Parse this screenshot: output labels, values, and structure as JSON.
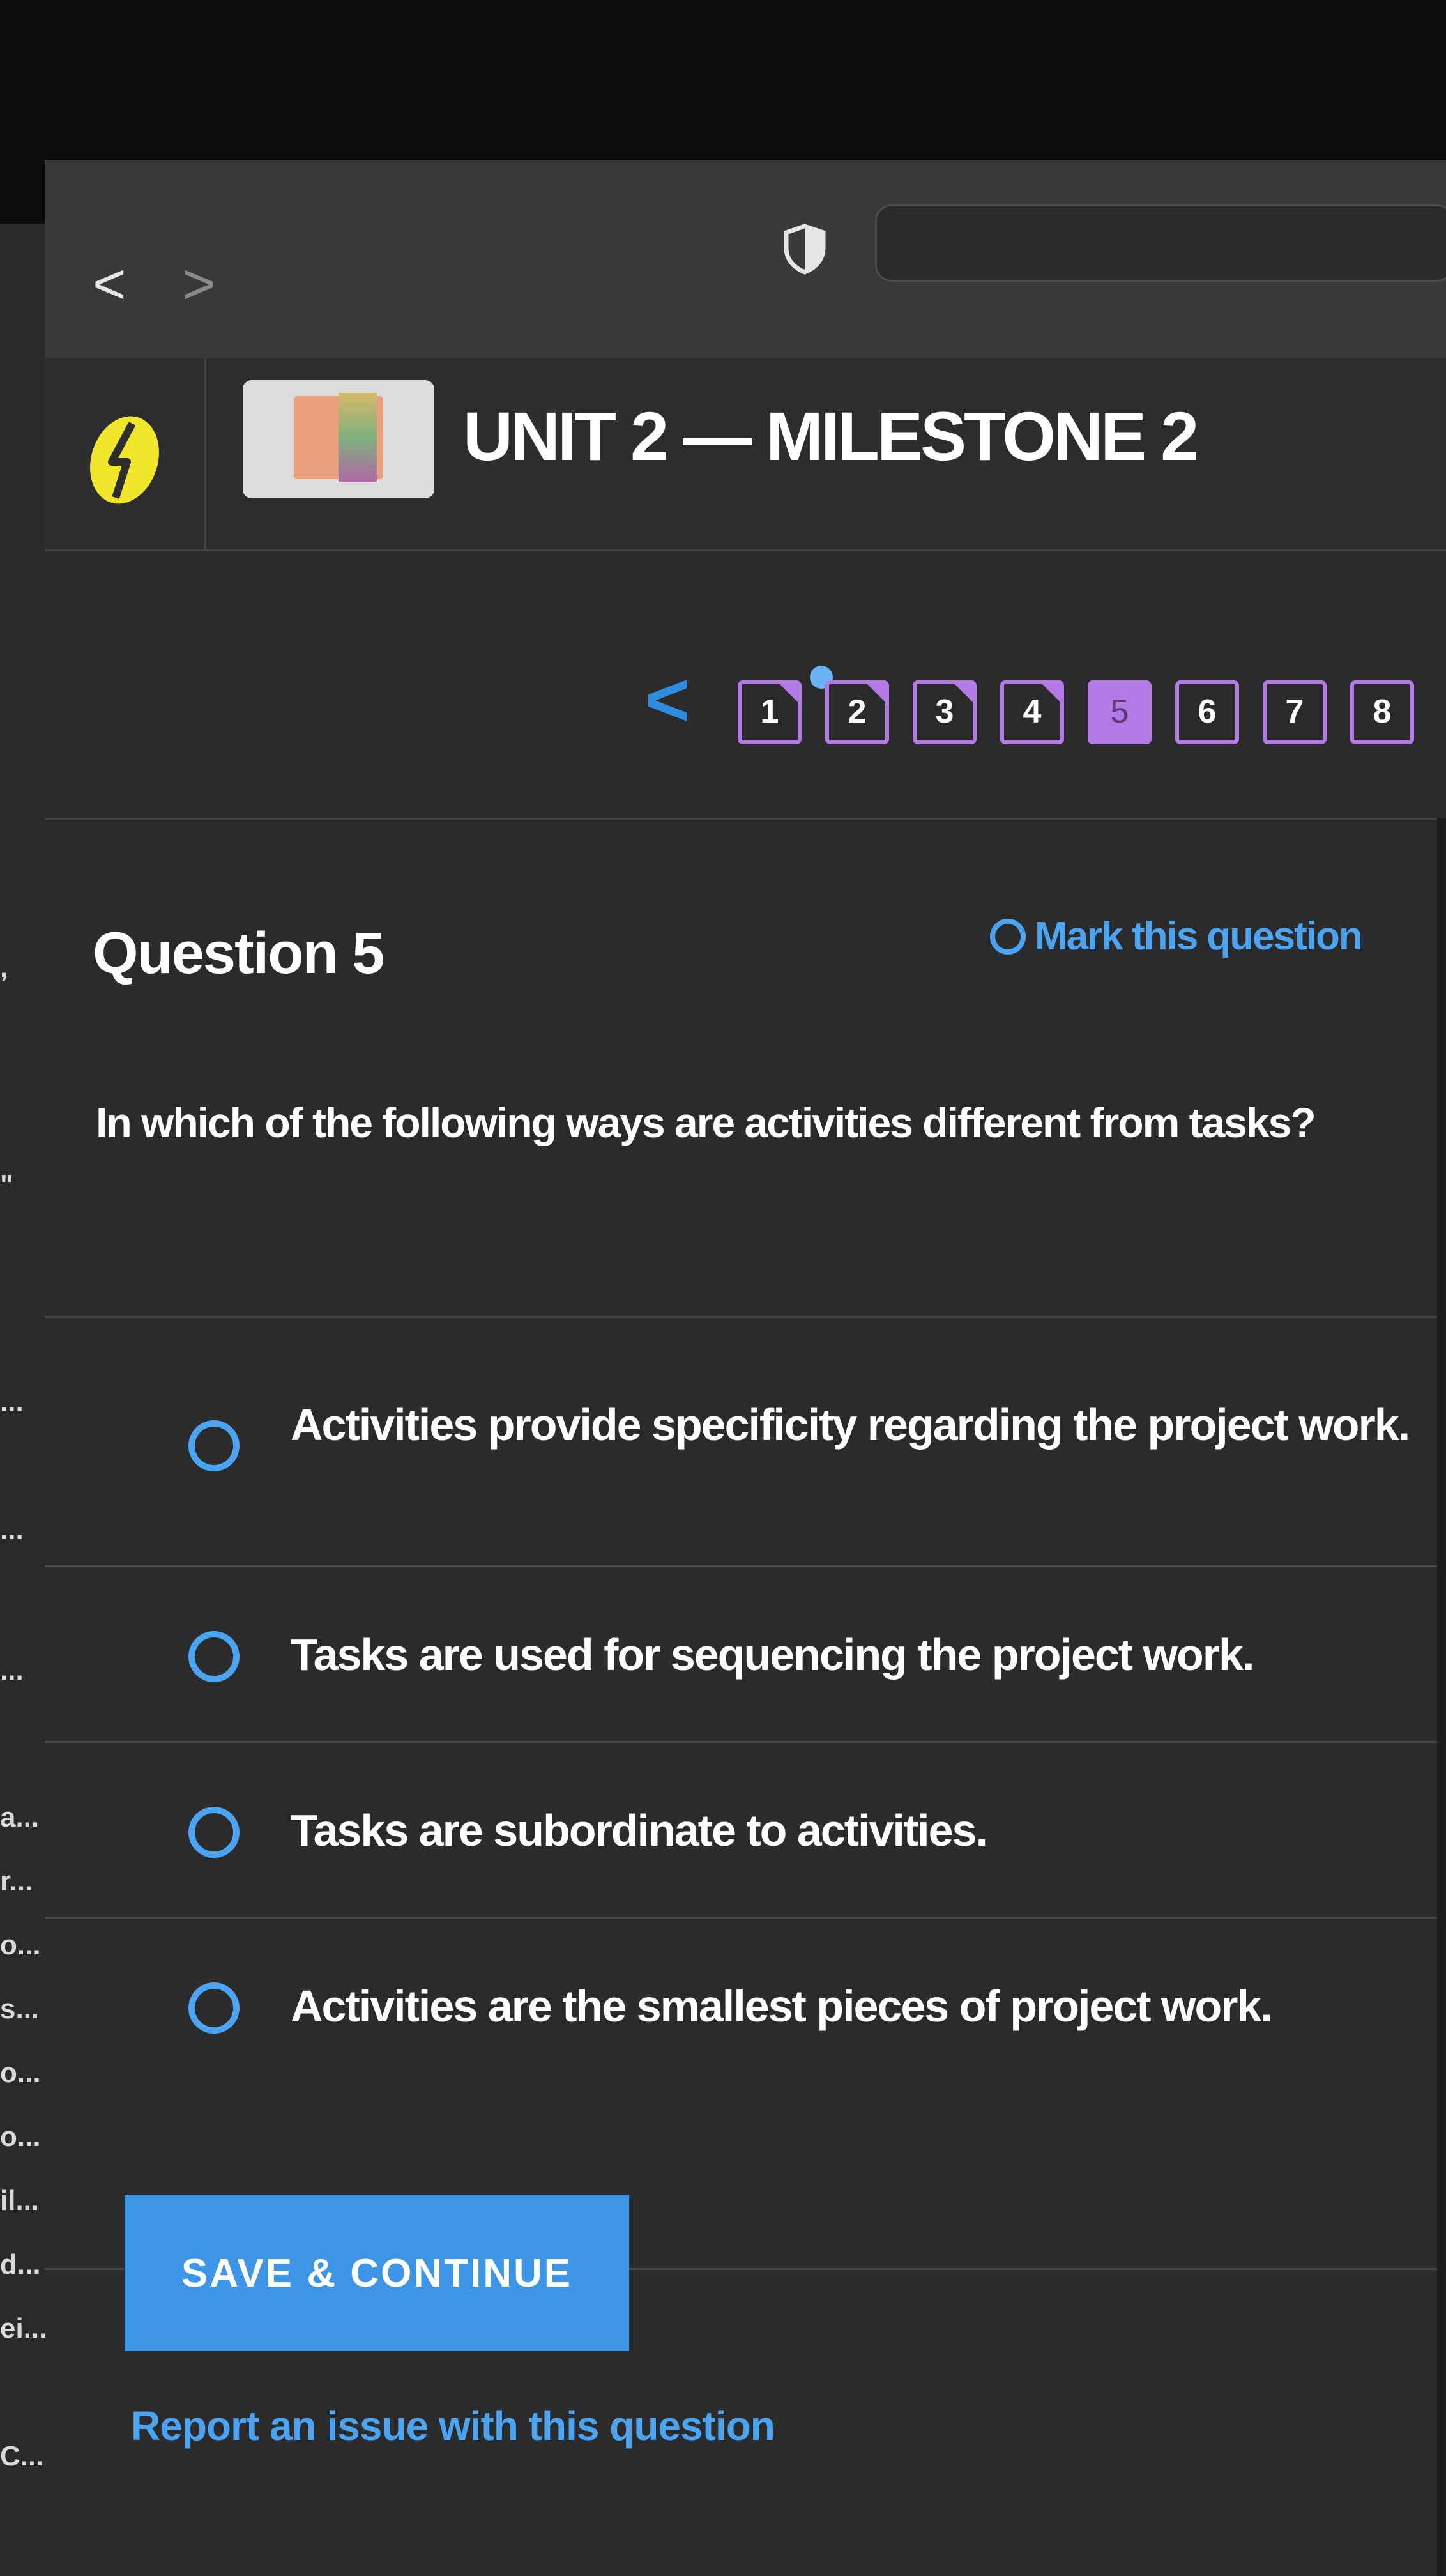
{
  "browser": {
    "back_glyph": "<",
    "forward_glyph": ">",
    "url": ""
  },
  "sidebar_fragments": [
    {
      "text": ","
    },
    {
      "text": "\""
    },
    {
      "text": "..."
    },
    {
      "text": "..."
    },
    {
      "text": "..."
    },
    {
      "text": "a..."
    },
    {
      "text": "r..."
    },
    {
      "text": "o..."
    },
    {
      "text": "s..."
    },
    {
      "text": "o..."
    },
    {
      "text": "o..."
    },
    {
      "text": "il..."
    },
    {
      "text": "d..."
    },
    {
      "text": "ei..."
    },
    {
      "text": "C..."
    }
  ],
  "header": {
    "unit_title": "UNIT 2 — MILESTONE 2"
  },
  "question_nav": {
    "prev_glyph": "<",
    "items": [
      {
        "label": "1",
        "state": "answered"
      },
      {
        "label": "2",
        "state": "answered"
      },
      {
        "label": "3",
        "state": "answered"
      },
      {
        "label": "4",
        "state": "answered"
      },
      {
        "label": "5",
        "state": "current"
      },
      {
        "label": "6",
        "state": "unanswered"
      },
      {
        "label": "7",
        "state": "unanswered"
      },
      {
        "label": "8",
        "state": "unanswered"
      }
    ]
  },
  "question": {
    "title": "Question 5",
    "mark_label": "Mark this question",
    "prompt": "In which of the following ways are activities different from tasks?",
    "answers": [
      {
        "text": "Activities provide specificity regarding the project work."
      },
      {
        "text": "Tasks are used for sequencing the project work."
      },
      {
        "text": "Tasks are subordinate to activities."
      },
      {
        "text": "Activities are the smallest pieces of project work."
      }
    ]
  },
  "actions": {
    "save_label": "SAVE & CONTINUE",
    "report_label": "Report an issue with this question"
  },
  "colors": {
    "accent_blue": "#3d95e8",
    "link_blue": "#4aa4f2",
    "nav_purple": "#b37ae6",
    "logo_yellow": "#f2e62a",
    "background": "#2b2b2c"
  },
  "icons": {
    "logo": "lightning-bolt-logo",
    "shield": "shield-icon",
    "mark": "circle-outline-icon"
  }
}
